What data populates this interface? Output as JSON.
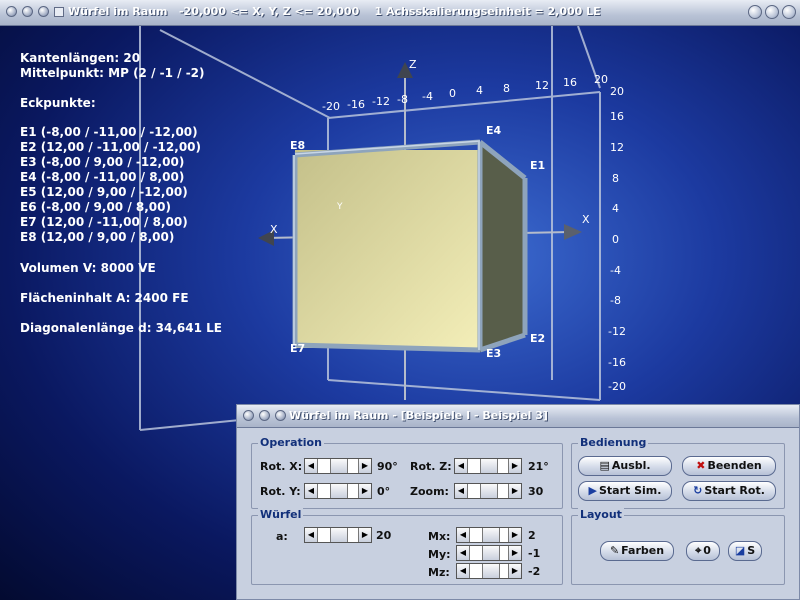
{
  "window": {
    "title": "Würfel im Raum   -20,000 <= X, Y, Z <= 20,000    1 Achsskalierungseinheit = 2,000 LE"
  },
  "info": {
    "kantenlaengen": "Kantenlängen: 20",
    "mittelpunkt": "Mittelpunkt: MP (2 / -1 / -2)",
    "eckpunkte_heading": "Eckpunkte:",
    "eckpunkte": [
      "E1 (-8,00 / -11,00 / -12,00)",
      "E2 (12,00 / -11,00 / -12,00)",
      "E3 (-8,00 / 9,00 / -12,00)",
      "E4 (-8,00 / -11,00 / 8,00)",
      "E5 (12,00 / 9,00 / -12,00)",
      "E6 (-8,00 / 9,00 / 8,00)",
      "E7 (12,00 / -11,00 / 8,00)",
      "E8 (12,00 / 9,00 / 8,00)"
    ],
    "volumen": "Volumen V: 8000 VE",
    "flaecheninhalt": "Flächeninhalt A: 2400 FE",
    "diagonale": "Diagonalenlänge d: 34,641 LE"
  },
  "scene": {
    "axes": {
      "x": "X",
      "y": "Y",
      "z": "Z"
    },
    "top_ticks": [
      "-20",
      "-16",
      "-12",
      "-8",
      "-4",
      "0",
      "4",
      "8",
      "12",
      "16",
      "20"
    ],
    "right_ticks": [
      "20",
      "16",
      "12",
      "8",
      "4",
      "0",
      "-4",
      "-8",
      "-12",
      "-16",
      "-20"
    ],
    "vertex_labels": {
      "e1": "E1",
      "e2": "E2",
      "e3": "E3",
      "e4": "E4",
      "e7": "E7",
      "e8": "E8"
    },
    "colors": {
      "cube_face": "#e8e3a0",
      "cube_edge": "#8aa0b8",
      "background": "#1c3aa0"
    }
  },
  "control": {
    "title": "Würfel im Raum - [Beispiele I - Beispiel 3]",
    "operation": {
      "label": "Operation",
      "rotx_label": "Rot. X:",
      "rotx_value": "90°",
      "rotx_level": 0.5,
      "roty_label": "Rot. Y:",
      "roty_value": "0°",
      "roty_level": 0.5,
      "rotz_label": "Rot. Z:",
      "rotz_value": "21°",
      "rotz_level": 0.5,
      "zoom_label": "Zoom:",
      "zoom_value": "30",
      "zoom_level": 0.5
    },
    "wuerfel": {
      "label": "Würfel",
      "a_label": "a:",
      "a_value": "20",
      "a_level": 0.5,
      "mx_label": "Mx:",
      "mx_value": "2",
      "my_label": "My:",
      "my_value": "-1",
      "mz_label": "Mz:",
      "mz_value": "-2"
    },
    "bedienung": {
      "label": "Bedienung",
      "ausbl": "Ausbl.",
      "beenden": "Beenden",
      "start_sim": "Start Sim.",
      "start_rot": "Start Rot."
    },
    "layout": {
      "label": "Layout",
      "farben": "Farben",
      "zero": "0",
      "s": "S"
    }
  }
}
